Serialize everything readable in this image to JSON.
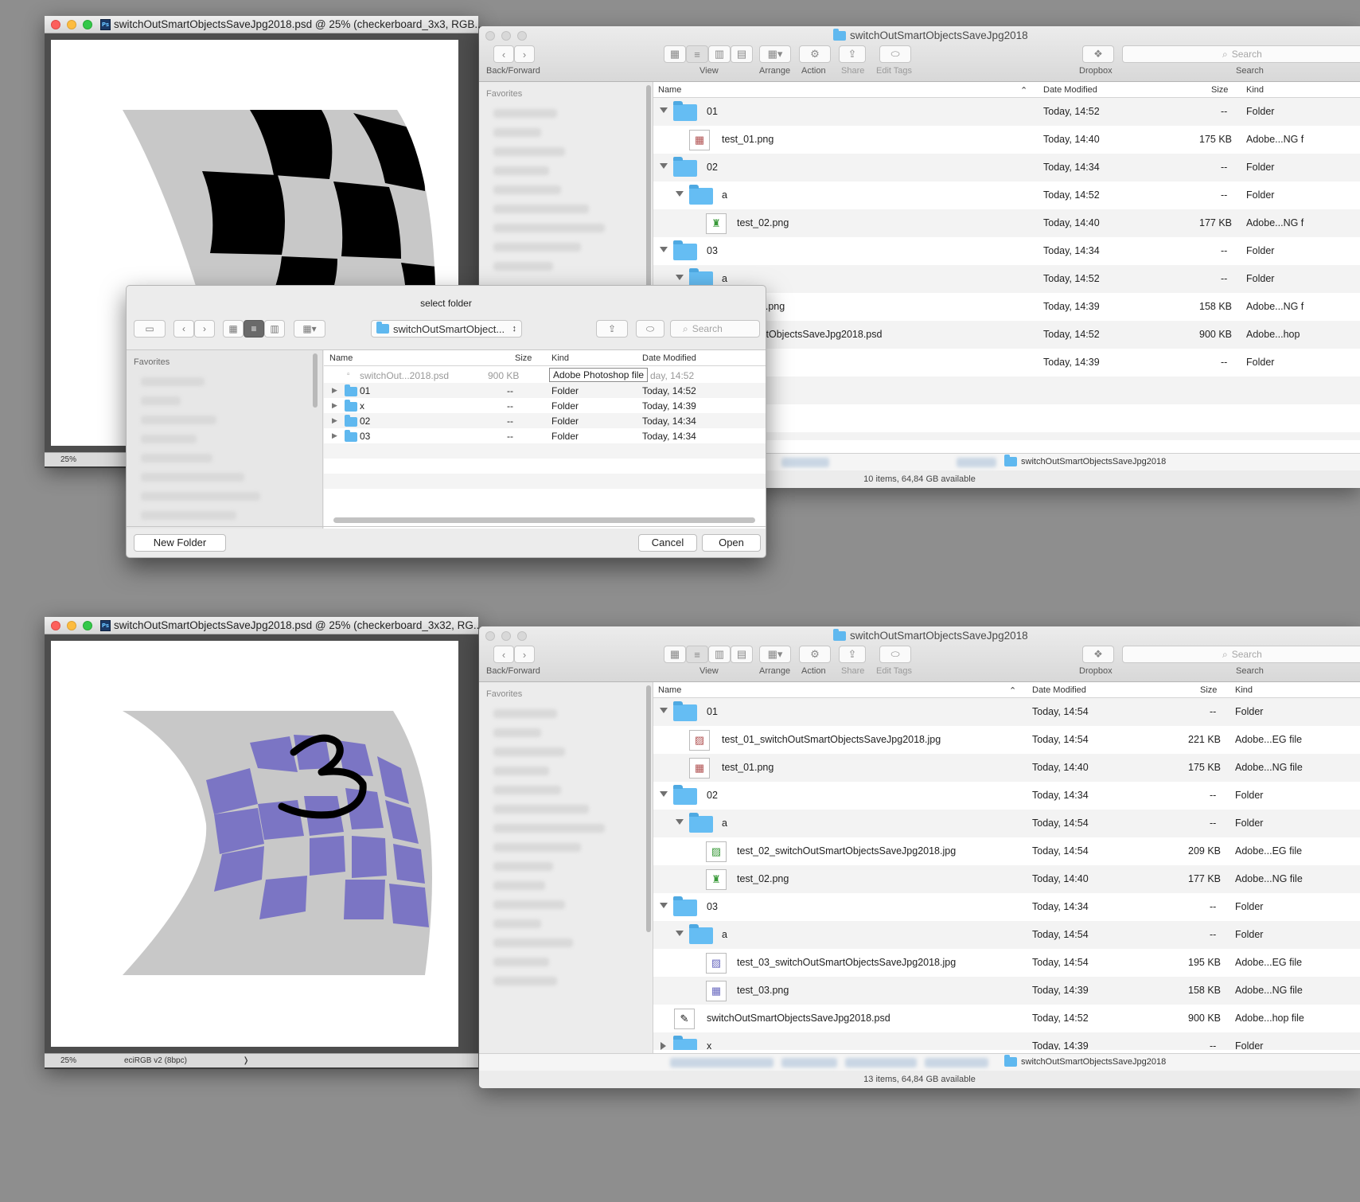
{
  "top": {
    "photoshop": {
      "title": "switchOutSmartObjectsSaveJpg2018.psd @ 25% (checkerboard_3x3, RGB...",
      "zoom": "25%"
    },
    "finder": {
      "title": "switchOutSmartObjectsSaveJpg2018",
      "toolbar": {
        "back_forward": "Back/Forward",
        "view": "View",
        "arrange": "Arrange",
        "action": "Action",
        "share": "Share",
        "edit_tags": "Edit Tags",
        "dropbox": "Dropbox",
        "search": "Search",
        "search_placeholder": "Search"
      },
      "sidebar_heading": "Favorites",
      "columns": {
        "name": "Name",
        "date": "Date Modified",
        "size": "Size",
        "kind": "Kind"
      },
      "rows": [
        {
          "name": "01",
          "date": "Today, 14:52",
          "size": "--",
          "kind": "Folder"
        },
        {
          "name": "test_01.png",
          "date": "Today, 14:40",
          "size": "175 KB",
          "kind": "Adobe...NG f"
        },
        {
          "name": "02",
          "date": "Today, 14:34",
          "size": "--",
          "kind": "Folder"
        },
        {
          "name": "a",
          "date": "Today, 14:52",
          "size": "--",
          "kind": "Folder"
        },
        {
          "name": "test_02.png",
          "date": "Today, 14:40",
          "size": "177 KB",
          "kind": "Adobe...NG f"
        },
        {
          "name": "03",
          "date": "Today, 14:34",
          "size": "--",
          "kind": "Folder"
        },
        {
          "name": "a",
          "date": "Today, 14:52",
          "size": "--",
          "kind": "Folder"
        },
        {
          "name": "_03.png",
          "date": "Today, 14:39",
          "size": "158 KB",
          "kind": "Adobe...NG f"
        },
        {
          "name": "martObjectsSaveJpg2018.psd",
          "date": "Today, 14:52",
          "size": "900 KB",
          "kind": "Adobe...hop"
        },
        {
          "name": "",
          "date": "Today, 14:39",
          "size": "--",
          "kind": "Folder"
        }
      ],
      "path": "switchOutSmartObjectsSaveJpg2018",
      "status": "10 items, 64,84 GB available"
    },
    "dialog": {
      "title": "select folder",
      "location": "switchOutSmartObject...",
      "search_placeholder": "Search",
      "sidebar_heading": "Favorites",
      "columns": {
        "name": "Name",
        "size": "Size",
        "kind": "Kind",
        "date": "Date Modified"
      },
      "rows": [
        {
          "name": "switchOut...2018.psd",
          "size": "900 KB",
          "kind": "",
          "date": "day, 14:52"
        },
        {
          "name": "01",
          "size": "--",
          "kind": "Folder",
          "date": "Today, 14:52"
        },
        {
          "name": "x",
          "size": "--",
          "kind": "Folder",
          "date": "Today, 14:39"
        },
        {
          "name": "02",
          "size": "--",
          "kind": "Folder",
          "date": "Today, 14:34"
        },
        {
          "name": "03",
          "size": "--",
          "kind": "Folder",
          "date": "Today, 14:34"
        }
      ],
      "tooltip": "Adobe Photoshop file",
      "new_folder": "New Folder",
      "cancel": "Cancel",
      "open": "Open"
    }
  },
  "bottom": {
    "photoshop": {
      "title": "switchOutSmartObjectsSaveJpg2018.psd @ 25% (checkerboard_3x32, RG...",
      "zoom": "25%",
      "profile": "eciRGB v2 (8bpc)",
      "arrow": "❭"
    },
    "finder": {
      "title": "switchOutSmartObjectsSaveJpg2018",
      "toolbar": {
        "back_forward": "Back/Forward",
        "view": "View",
        "arrange": "Arrange",
        "action": "Action",
        "share": "Share",
        "edit_tags": "Edit Tags",
        "dropbox": "Dropbox",
        "search": "Search",
        "search_placeholder": "Search"
      },
      "sidebar_heading": "Favorites",
      "columns": {
        "name": "Name",
        "date": "Date Modified",
        "size": "Size",
        "kind": "Kind"
      },
      "rows": [
        {
          "name": "01",
          "date": "Today, 14:54",
          "size": "--",
          "kind": "Folder"
        },
        {
          "name": "test_01_switchOutSmartObjectsSaveJpg2018.jpg",
          "date": "Today, 14:54",
          "size": "221 KB",
          "kind": "Adobe...EG file"
        },
        {
          "name": "test_01.png",
          "date": "Today, 14:40",
          "size": "175 KB",
          "kind": "Adobe...NG file"
        },
        {
          "name": "02",
          "date": "Today, 14:34",
          "size": "--",
          "kind": "Folder"
        },
        {
          "name": "a",
          "date": "Today, 14:54",
          "size": "--",
          "kind": "Folder"
        },
        {
          "name": "test_02_switchOutSmartObjectsSaveJpg2018.jpg",
          "date": "Today, 14:54",
          "size": "209 KB",
          "kind": "Adobe...EG file"
        },
        {
          "name": "test_02.png",
          "date": "Today, 14:40",
          "size": "177 KB",
          "kind": "Adobe...NG file"
        },
        {
          "name": "03",
          "date": "Today, 14:34",
          "size": "--",
          "kind": "Folder"
        },
        {
          "name": "a",
          "date": "Today, 14:54",
          "size": "--",
          "kind": "Folder"
        },
        {
          "name": "test_03_switchOutSmartObjectsSaveJpg2018.jpg",
          "date": "Today, 14:54",
          "size": "195 KB",
          "kind": "Adobe...EG file"
        },
        {
          "name": "test_03.png",
          "date": "Today, 14:39",
          "size": "158 KB",
          "kind": "Adobe...NG file"
        },
        {
          "name": "switchOutSmartObjectsSaveJpg2018.psd",
          "date": "Today, 14:52",
          "size": "900 KB",
          "kind": "Adobe...hop file"
        },
        {
          "name": "x",
          "date": "Today, 14:39",
          "size": "--",
          "kind": "Folder"
        }
      ],
      "path": "switchOutSmartObjectsSaveJpg2018",
      "status": "13 items, 64,84 GB available"
    }
  },
  "icons": {
    "chevron_left": "‹",
    "chevron_right": "›",
    "search": "⌕",
    "updown": "↕",
    "gear": "⚙",
    "share": "⇪",
    "dropbox": "❖",
    "disclosure": "▾"
  },
  "colors": {
    "desktop": "#8e8e8e",
    "folder": "#65bdf3",
    "checker_dark": "#000000",
    "checker_light": "#c8c8c8",
    "checker_purple": "#7b75c4",
    "selection": "#6a6a6a"
  }
}
